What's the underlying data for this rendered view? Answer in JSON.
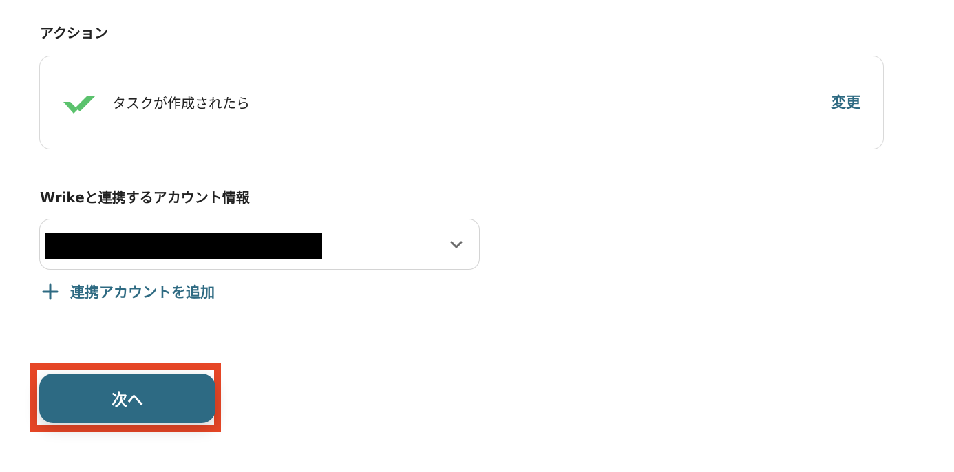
{
  "action_section": {
    "title": "アクション",
    "app_icon": "wrike-check-icon",
    "trigger_label": "タスクが作成されたら",
    "change_label": "変更"
  },
  "account_section": {
    "title": "Wrikeと連携するアカウント情報",
    "selected_value": "",
    "add_account_label": "連携アカウントを追加"
  },
  "footer": {
    "next_label": "次へ"
  },
  "colors": {
    "accent": "#2e6a82",
    "button": "#2d6a83",
    "highlight": "#e64626",
    "wrike_green": "#5bc26d"
  }
}
